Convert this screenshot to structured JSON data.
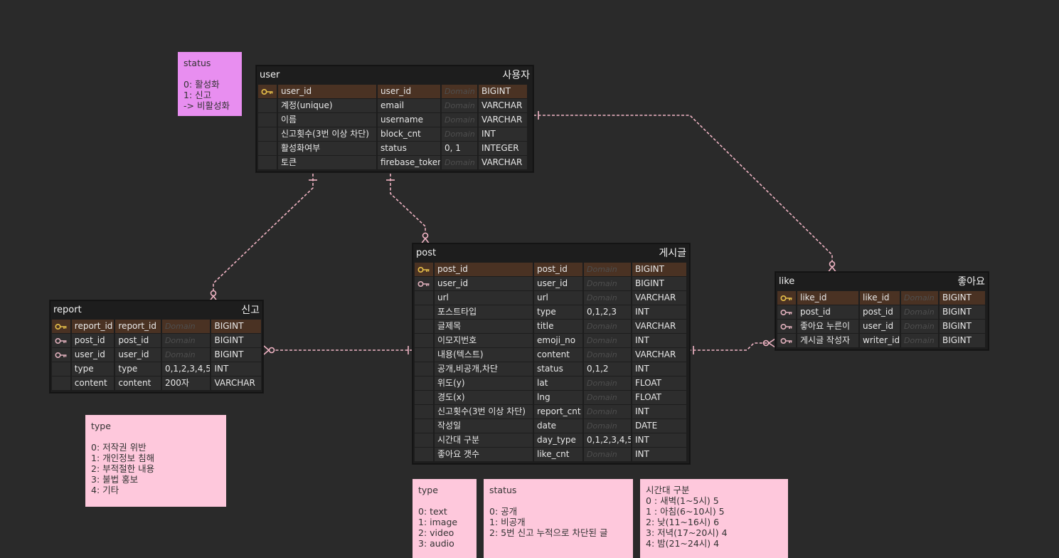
{
  "entities": {
    "user": {
      "name": "user",
      "logical": "사용자",
      "rows": [
        {
          "logical": "user_id",
          "physical": "user_id",
          "domain": "Domain",
          "type": "BIGINT",
          "key": "pk"
        },
        {
          "logical": "계정(unique)",
          "physical": "email",
          "domain": "Domain",
          "type": "VARCHAR",
          "key": ""
        },
        {
          "logical": "이름",
          "physical": "username",
          "domain": "Domain",
          "type": "VARCHAR",
          "key": ""
        },
        {
          "logical": "신고횟수(3번 이상 차단)",
          "physical": "block_cnt",
          "domain": "Domain",
          "type": "INT",
          "key": ""
        },
        {
          "logical": "활성화여부",
          "physical": "status",
          "domain": "0, 1",
          "type": "INTEGER",
          "key": ""
        },
        {
          "logical": "토큰",
          "physical": "firebase_token",
          "domain": "Domain",
          "type": "VARCHAR",
          "key": ""
        }
      ]
    },
    "post": {
      "name": "post",
      "logical": "게시글",
      "rows": [
        {
          "logical": "post_id",
          "physical": "post_id",
          "domain": "Domain",
          "type": "BIGINT",
          "key": "pk"
        },
        {
          "logical": "user_id",
          "physical": "user_id",
          "domain": "Domain",
          "type": "BIGINT",
          "key": "fk"
        },
        {
          "logical": "url",
          "physical": "url",
          "domain": "Domain",
          "type": "VARCHAR",
          "key": ""
        },
        {
          "logical": "포스트타입",
          "physical": "type",
          "domain": "0,1,2,3",
          "type": "INT",
          "key": ""
        },
        {
          "logical": "글제목",
          "physical": "title",
          "domain": "Domain",
          "type": "VARCHAR",
          "key": ""
        },
        {
          "logical": "이모지번호",
          "physical": "emoji_no",
          "domain": "Domain",
          "type": "INT",
          "key": ""
        },
        {
          "logical": "내용(텍스트)",
          "physical": "content",
          "domain": "Domain",
          "type": "VARCHAR",
          "key": ""
        },
        {
          "logical": "공개,비공개,차단",
          "physical": "status",
          "domain": "0,1,2",
          "type": "INT",
          "key": ""
        },
        {
          "logical": "위도(y)",
          "physical": "lat",
          "domain": "Domain",
          "type": "FLOAT",
          "key": ""
        },
        {
          "logical": "경도(x)",
          "physical": "lng",
          "domain": "Domain",
          "type": "FLOAT",
          "key": ""
        },
        {
          "logical": "신고횟수(3번 이상 차단)",
          "physical": "report_cnt",
          "domain": "Domain",
          "type": "INT",
          "key": ""
        },
        {
          "logical": "작성일",
          "physical": "date",
          "domain": "Domain",
          "type": "DATE",
          "key": ""
        },
        {
          "logical": "시간대 구분",
          "physical": "day_type",
          "domain": "0,1,2,3,4,5",
          "type": "INT",
          "key": ""
        },
        {
          "logical": "좋아요 갯수",
          "physical": "like_cnt",
          "domain": "Domain",
          "type": "INT",
          "key": ""
        }
      ]
    },
    "report": {
      "name": "report",
      "logical": "신고",
      "rows": [
        {
          "logical": "report_id",
          "physical": "report_id",
          "domain": "Domain",
          "type": "BIGINT",
          "key": "pk"
        },
        {
          "logical": "post_id",
          "physical": "post_id",
          "domain": "Domain",
          "type": "BIGINT",
          "key": "fk"
        },
        {
          "logical": "user_id",
          "physical": "user_id",
          "domain": "Domain",
          "type": "BIGINT",
          "key": "fk"
        },
        {
          "logical": "type",
          "physical": "type",
          "domain": "0,1,2,3,4,5",
          "type": "INT",
          "key": ""
        },
        {
          "logical": "content",
          "physical": "content",
          "domain": "200자",
          "type": "VARCHAR",
          "key": ""
        }
      ]
    },
    "like": {
      "name": "like",
      "logical": "좋아요",
      "rows": [
        {
          "logical": "like_id",
          "physical": "like_id",
          "domain": "Domain",
          "type": "BIGINT",
          "key": "pk"
        },
        {
          "logical": "post_id",
          "physical": "post_id",
          "domain": "Domain",
          "type": "BIGINT",
          "key": "fk"
        },
        {
          "logical": "좋아요 누른이",
          "physical": "user_id",
          "domain": "Domain",
          "type": "BIGINT",
          "key": "fk"
        },
        {
          "logical": "게시글 작성자",
          "physical": "writer_id",
          "domain": "Domain",
          "type": "BIGINT",
          "key": "fk"
        }
      ]
    }
  },
  "notes": {
    "user_status": {
      "color": "#e88ef0",
      "lines": [
        "status",
        "",
        "0: 활성화",
        "1: 신고",
        "-> 비활성화"
      ]
    },
    "report_type": {
      "color": "#fec8dc",
      "lines": [
        "type",
        "",
        "0: 저작권 위반",
        "1: 개인정보 침해",
        "2: 부적절한 내용",
        "3: 불법 홍보",
        "4: 기타"
      ]
    },
    "post_type": {
      "color": "#fec8dc",
      "lines": [
        "type",
        "",
        "0: text",
        "1: image",
        "2: video",
        "3: audio"
      ]
    },
    "post_status": {
      "color": "#fec8dc",
      "lines": [
        "status",
        "",
        "0: 공개",
        "1: 비공개",
        "2: 5번 신고 누적으로 차단된 글"
      ]
    },
    "day_type": {
      "color": "#fec8dc",
      "lines": [
        "시간대 구분",
        "0 : 새벽(1~5시) 5",
        "1 : 아침(6~10시) 5",
        "2: 낮(11~16시) 6",
        "3: 저녁(17~20시) 4",
        "4: 밤(21~24시) 4"
      ]
    }
  },
  "colors": {
    "relationship_line": "#f0b4c4",
    "pk_row": "#4a3223",
    "pk_key_icon": "#e8c04a",
    "fk_key_icon": "#e0b0bc"
  },
  "icons": {
    "pk": "key-icon",
    "fk": "foreign-key-icon"
  }
}
